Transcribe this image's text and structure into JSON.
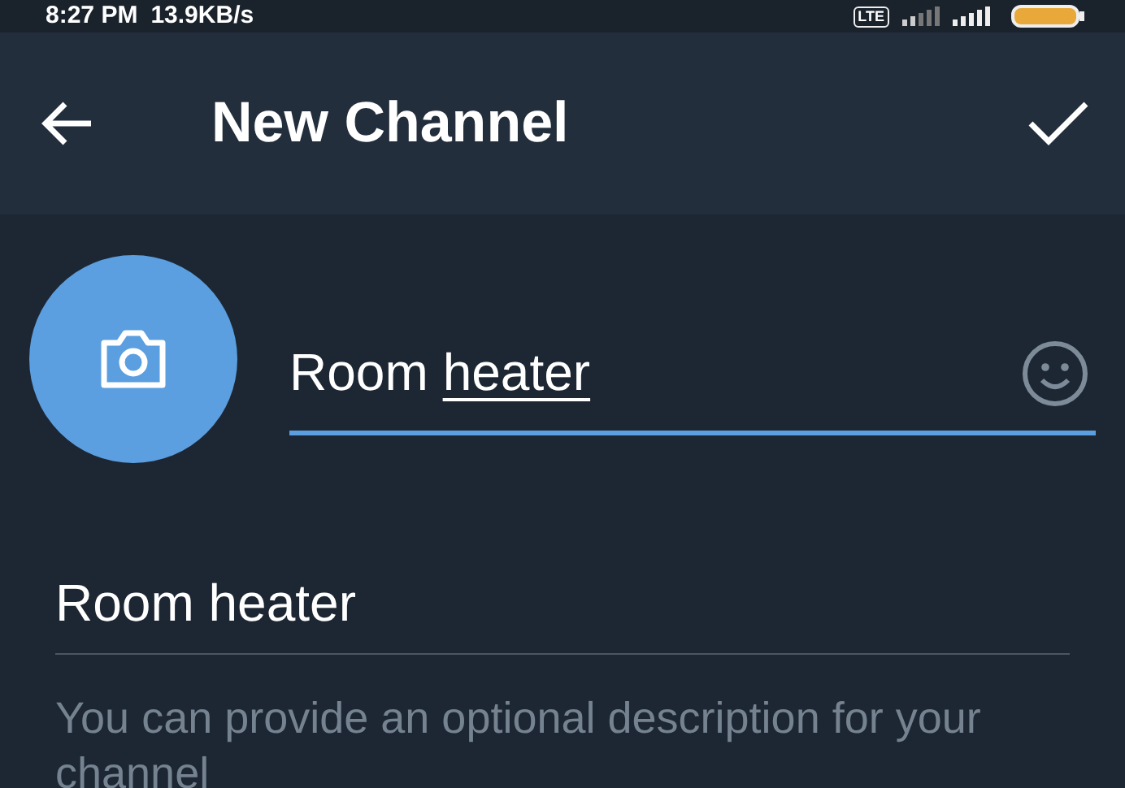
{
  "status_bar": {
    "time": "8:27 PM",
    "speed": "13.9KB/s",
    "network": "LTE"
  },
  "header": {
    "title": "New Channel"
  },
  "name_field": {
    "value_parts": [
      {
        "text": "Room",
        "underlined": false
      },
      {
        "text": "heater",
        "underlined": true
      }
    ]
  },
  "description_field": {
    "value": "Room heater"
  },
  "hint": "You can provide an optional description for your channel"
}
